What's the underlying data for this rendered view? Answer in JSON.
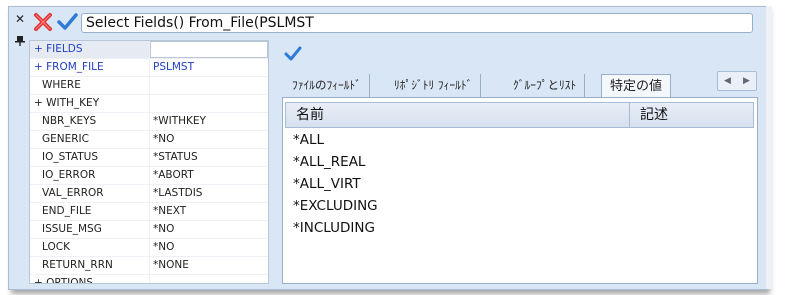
{
  "toolbar": {
    "close_glyph": "✕",
    "pin_glyph": "📌",
    "command_text": "Select Fields() From_File(PSLMST"
  },
  "params": [
    {
      "name": "+ FIELDS",
      "value": "",
      "style": "selected",
      "indent": false
    },
    {
      "name": "+ FROM_FILE",
      "value": "PSLMST",
      "style": "blue",
      "indent": false
    },
    {
      "name": "WHERE",
      "value": "",
      "style": "",
      "indent": true
    },
    {
      "name": "+ WITH_KEY",
      "value": "",
      "style": "",
      "indent": false
    },
    {
      "name": "NBR_KEYS",
      "value": "*WITHKEY",
      "style": "",
      "indent": true
    },
    {
      "name": "GENERIC",
      "value": "*NO",
      "style": "",
      "indent": true
    },
    {
      "name": "IO_STATUS",
      "value": "*STATUS",
      "style": "",
      "indent": true
    },
    {
      "name": "IO_ERROR",
      "value": "*ABORT",
      "style": "",
      "indent": true
    },
    {
      "name": "VAL_ERROR",
      "value": "*LASTDIS",
      "style": "",
      "indent": true
    },
    {
      "name": "END_FILE",
      "value": "*NEXT",
      "style": "",
      "indent": true
    },
    {
      "name": "ISSUE_MSG",
      "value": "*NO",
      "style": "",
      "indent": true
    },
    {
      "name": "LOCK",
      "value": "*NO",
      "style": "",
      "indent": true
    },
    {
      "name": "RETURN_RRN",
      "value": "*NONE",
      "style": "",
      "indent": true
    },
    {
      "name": "+ OPTIONS",
      "value": "",
      "style": "",
      "indent": false
    }
  ],
  "tabs": [
    {
      "label": "ﾌｧｲﾙのﾌｨｰﾙﾄﾞ",
      "active": false
    },
    {
      "label": "ﾘﾎﾟｼﾞﾄﾘ ﾌｨｰﾙﾄﾞ",
      "active": false
    },
    {
      "label": "ｸﾞﾙｰﾌﾟとﾘｽﾄ",
      "active": false
    },
    {
      "label": "特定の値",
      "active": true
    }
  ],
  "tab_scroll": {
    "left": "◀",
    "right": "▶"
  },
  "list": {
    "columns": {
      "name": "名前",
      "desc": "記述"
    },
    "items": [
      "*ALL",
      "*ALL_REAL",
      "*ALL_VIRT",
      "*EXCLUDING",
      "*INCLUDING"
    ]
  },
  "colors": {
    "accent": "#2040c0",
    "panel_bg": "#d9e6f5",
    "cancel_red": "#e03030",
    "ok_blue": "#2e7bd6"
  }
}
